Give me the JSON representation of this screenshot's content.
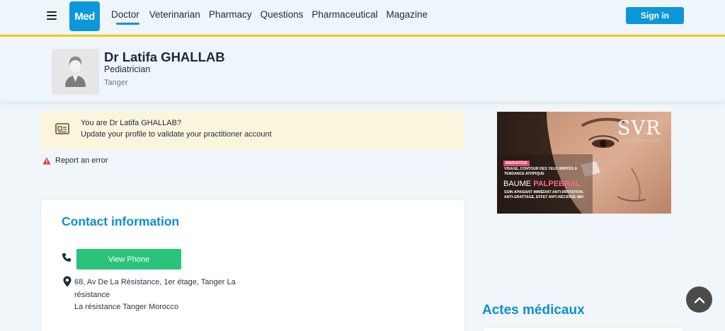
{
  "header": {
    "logo_text": "Med",
    "nav": [
      "Doctor",
      "Veterinarian",
      "Pharmacy",
      "Questions",
      "Pharmaceutical",
      "Magazine"
    ],
    "active_nav": "Doctor",
    "signin_label": "Sign in"
  },
  "profile": {
    "name": "Dr Latifa GHALLAB",
    "specialty": "Pediatrician",
    "city": "Tanger"
  },
  "claim": {
    "line1": "You are Dr Latifa GHALLAB?",
    "line2": "Update your profile to validate your practitioner account"
  },
  "report_label": "Report an error",
  "contact": {
    "title": "Contact information",
    "view_phone_label": "View Phone",
    "address_line1": "68, Av De La Résistance, 1er étage, Tanger La résistance",
    "address_line2": "La résistance Tanger Morocco"
  },
  "ad": {
    "brand": "SVR",
    "brand_sub": "LABORATOIRE DERMATOLOGIQUE",
    "tag": "INNOVATION",
    "headline": "VISAGE, CONTOUR DES YEUX IRRITÉS À TENDANCE ATOPIQUE",
    "product_prefix": "BAUME ",
    "product_highlight": "PALPEBRAL",
    "description": "SOIN APAISANT IMMÉDIAT ANTI-IRRITATION, ANTI-GRATTAGE, EFFET ANTI-RÉCIDIVE 48H"
  },
  "actes_title": "Actes médicaux",
  "colors": {
    "brand_blue": "#0d96d9",
    "accent_yellow": "#f5c915",
    "green_button": "#29c47a",
    "claim_bg": "#fbf5de"
  }
}
